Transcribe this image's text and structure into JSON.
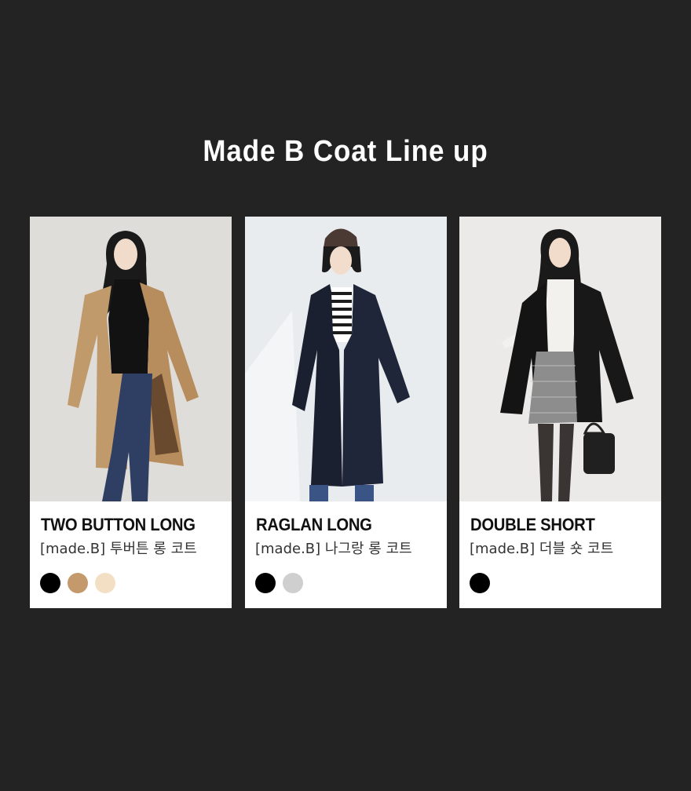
{
  "heading": "Made B Coat Line up",
  "products": [
    {
      "name": "TWO BUTTON LONG",
      "subtitle": "[made.B] 투버튼 롱 코트",
      "colors": [
        "#000000",
        "#c49a6c",
        "#f2dfc4"
      ],
      "photo_icon": "model-camel-coat-photo"
    },
    {
      "name": "RAGLAN LONG",
      "subtitle": "[made.B] 나그랑 롱 코트",
      "colors": [
        "#000000",
        "#cfcfcf"
      ],
      "photo_icon": "model-black-long-coat-photo"
    },
    {
      "name": "DOUBLE SHORT",
      "subtitle": "[made.B] 더블 숏 코트",
      "colors": [
        "#000000"
      ],
      "photo_icon": "model-black-short-coat-photo"
    }
  ]
}
